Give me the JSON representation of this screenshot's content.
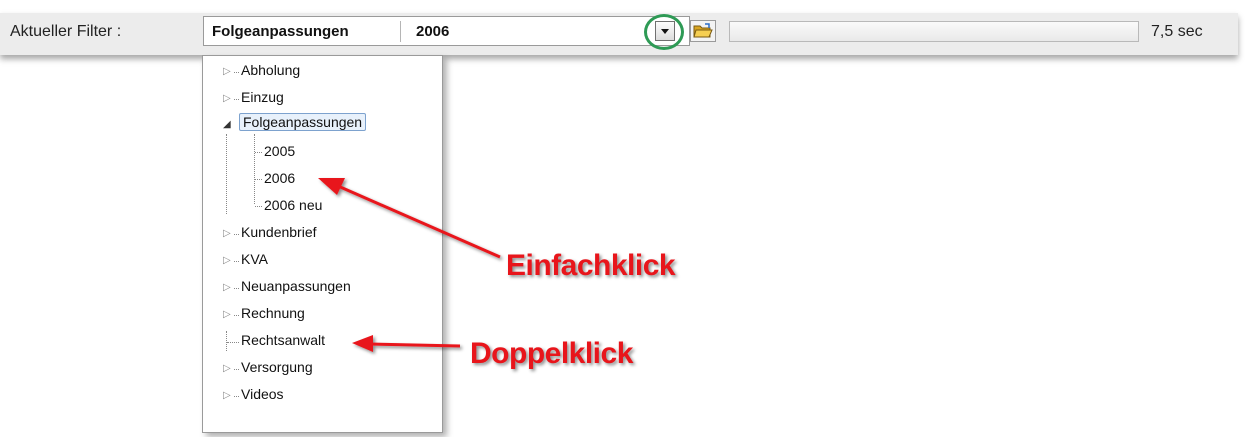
{
  "toolbar": {
    "filter_label": "Aktueller Filter :",
    "combo_category": "Folgeanpassungen",
    "combo_value": "2006",
    "time": "7,5 sec"
  },
  "tree": {
    "items": [
      {
        "label": "Abholung",
        "expandable": true,
        "expanded": false
      },
      {
        "label": "Einzug",
        "expandable": true,
        "expanded": false
      },
      {
        "label": "Folgeanpassungen",
        "expandable": true,
        "expanded": true,
        "selected": true,
        "children": [
          {
            "label": "2005"
          },
          {
            "label": "2006"
          },
          {
            "label": "2006 neu"
          }
        ]
      },
      {
        "label": "Kundenbrief",
        "expandable": true,
        "expanded": false
      },
      {
        "label": "KVA",
        "expandable": true,
        "expanded": false
      },
      {
        "label": "Neuanpassungen",
        "expandable": true,
        "expanded": false
      },
      {
        "label": "Rechnung",
        "expandable": true,
        "expanded": false
      },
      {
        "label": "Rechtsanwalt",
        "expandable": false
      },
      {
        "label": "Versorgung",
        "expandable": true,
        "expanded": false
      },
      {
        "label": "Videos",
        "expandable": true,
        "expanded": false
      }
    ]
  },
  "annotations": {
    "single_click": "Einfachklick",
    "double_click": "Doppelklick",
    "arrow_color": "#e8151b",
    "circle_color": "#2e9a55"
  },
  "icons": {
    "dropdown": "chevron-down-icon",
    "folder_open": "folder-open-icon",
    "expand": "triangle-right-icon",
    "collapse": "triangle-down-icon"
  }
}
